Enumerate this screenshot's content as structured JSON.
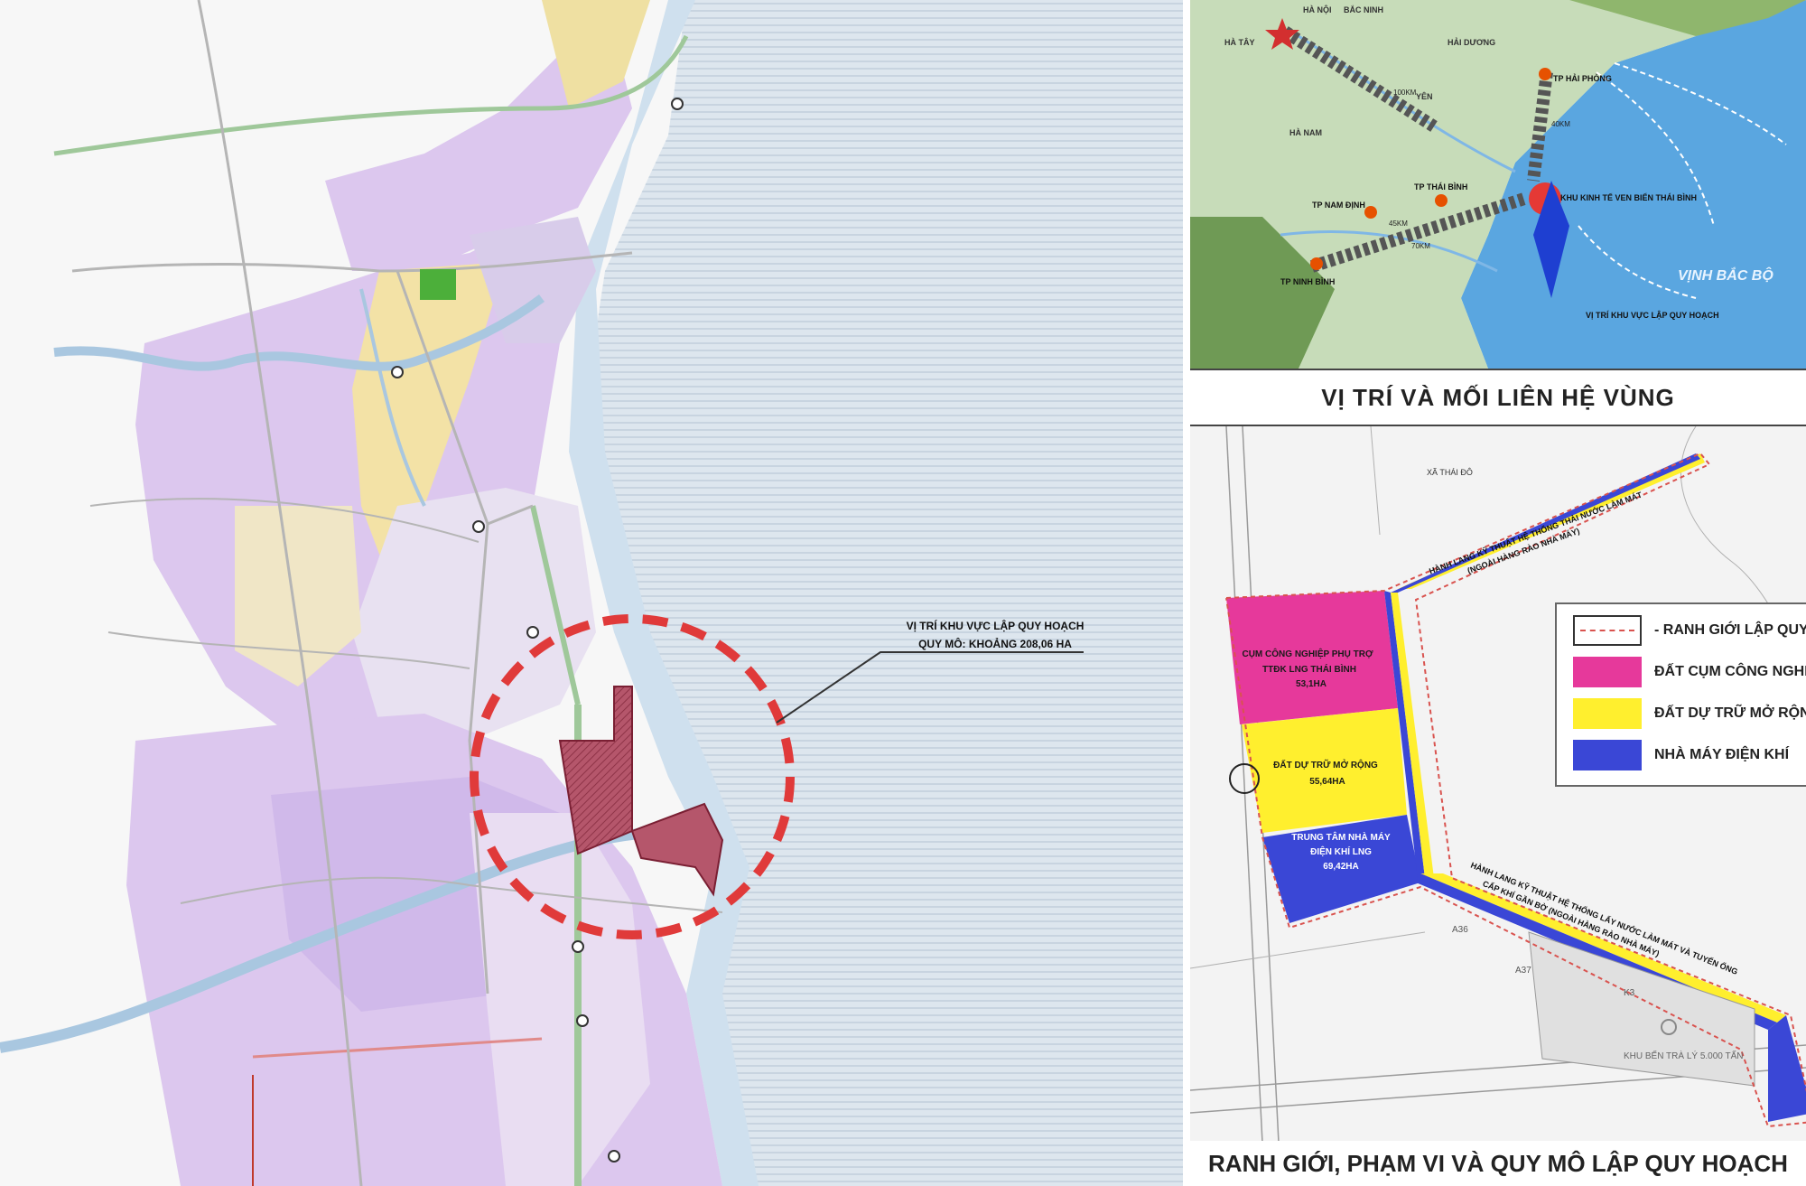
{
  "titles": {
    "regional": "VỊ TRÍ VÀ MỐI LIÊN HỆ VÙNG",
    "boundary": "RANH GIỚI, PHẠM VI VÀ QUY MÔ LẬP QUY HOẠCH"
  },
  "main_map": {
    "callout_line1": "VỊ TRÍ KHU VỰC LẬP QUY HOẠCH",
    "callout_line2": "QUY MÔ: KHOẢNG 208,06 HA"
  },
  "region_map": {
    "labels": {
      "ha_noi": "HÀ NỘI",
      "bac_ninh": "BẮC NINH",
      "ha_tay": "HÀ TÂY",
      "hai_duong": "HẢI DƯƠNG",
      "tp_hai_phong": "TP HẢI PHÒNG",
      "hung_yen": "YÊN",
      "ha_nam": "HÀ NAM",
      "tp_thai_binh": "TP THÁI BÌNH",
      "tp_nam_dinh": "TP NAM ĐỊNH",
      "tp_ninh_binh": "TP NINH BÌNH",
      "kkt": "KHU KINH TẾ VEN BIỂN THÁI BÌNH",
      "vinh_bac_bo": "VỊNH BẮC BỘ",
      "vi_tri": "VỊ TRÍ KHU VỰC LẬP QUY HOẠCH",
      "dist_100": "100KM",
      "dist_40": "40KM",
      "dist_45": "45KM",
      "dist_70": "70KM"
    }
  },
  "site_plan": {
    "zones": {
      "industrial": [
        "CỤM CÔNG NGHIỆP PHỤ TRỢ",
        "TTĐK LNG THÁI BÌNH",
        "53,1HA"
      ],
      "reserve": [
        "ĐẤT DỰ TRỮ MỞ RỘNG",
        "55,64HA"
      ],
      "plant": [
        "TRUNG TÂM NHÀ MÁY",
        "ĐIỆN KHÍ LNG",
        "69,42HA"
      ]
    },
    "corridor_top": [
      "HÀNH LANG KỸ THUẬT HỆ THỐNG THẢI NƯỚC LÀM MÁT",
      "(NGOÀI HÀNG RÀO NHÀ MÁY)"
    ],
    "corridor_bottom": [
      "HÀNH LANG KỸ THUẬT HỆ THỐNG LẤY NƯỚC LÀM MÁT VÀ TUYẾN ỐNG",
      "CẤP KHÍ GẦN BỜ (NGOÀI HÀNG RÀO NHÀ MÁY)"
    ],
    "village": "XÃ THÁI ĐÔ",
    "port": "KHU BẾN TRÀ LÝ 5.000 TẤN",
    "plots": [
      "A36",
      "A37",
      "K3"
    ],
    "legend": [
      {
        "label": "- RANH GIỚI LẬP QUY HOẠCH",
        "color": "#ffffff"
      },
      {
        "label": "ĐẤT CỤM CÔNG NGHIỆP",
        "color": "#e6399b"
      },
      {
        "label": "ĐẤT DỰ TRỮ MỞ RỘNG",
        "color": "#ffef2e"
      },
      {
        "label": "NHÀ MÁY ĐIỆN KHÍ",
        "color": "#3a47d6"
      }
    ]
  }
}
